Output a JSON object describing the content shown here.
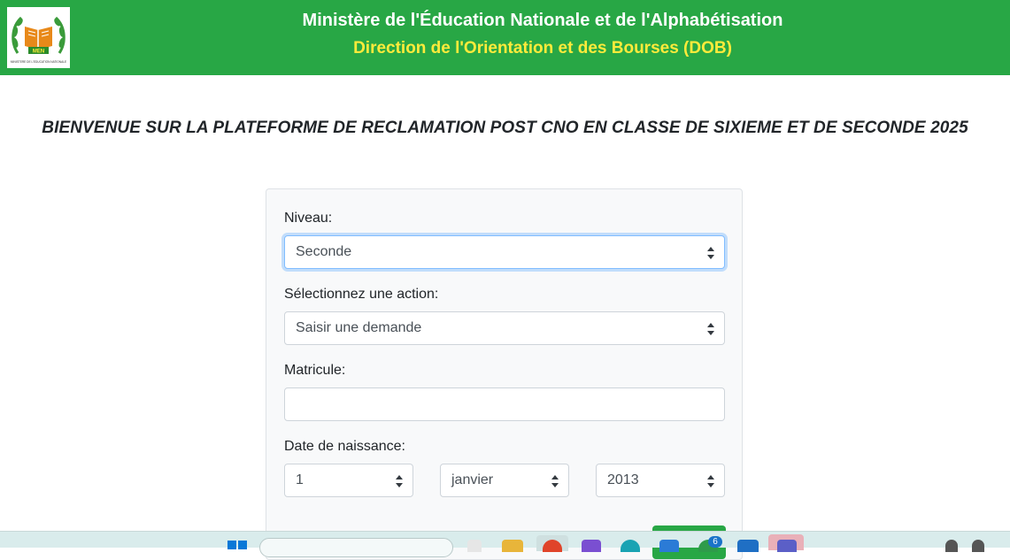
{
  "header": {
    "logo_text": "MEN",
    "logo_caption": "MINISTERE DE L'EDUCATION NATIONALE",
    "title": "Ministère de l'Éducation Nationale et de l'Alphabétisation",
    "subtitle": "Direction de l'Orientation et des Bourses (DOB)"
  },
  "welcome": "BIENVENUE SUR LA PLATEFORME DE RECLAMATION POST CNO EN CLASSE DE SIXIEME ET DE SECONDE 2025",
  "form": {
    "niveau_label": "Niveau:",
    "niveau_value": "Seconde",
    "action_label": "Sélectionnez une action:",
    "action_value": "Saisir une demande",
    "matricule_label": "Matricule:",
    "matricule_value": "",
    "dob_label": "Date de naissance:",
    "dob_day": "1",
    "dob_month": "janvier",
    "dob_year": "2013"
  },
  "taskbar": {
    "badge_count": "6"
  },
  "colors": {
    "header_bg": "#28a745",
    "subtitle": "#ffeb3b",
    "focus_border": "#80bdff"
  }
}
